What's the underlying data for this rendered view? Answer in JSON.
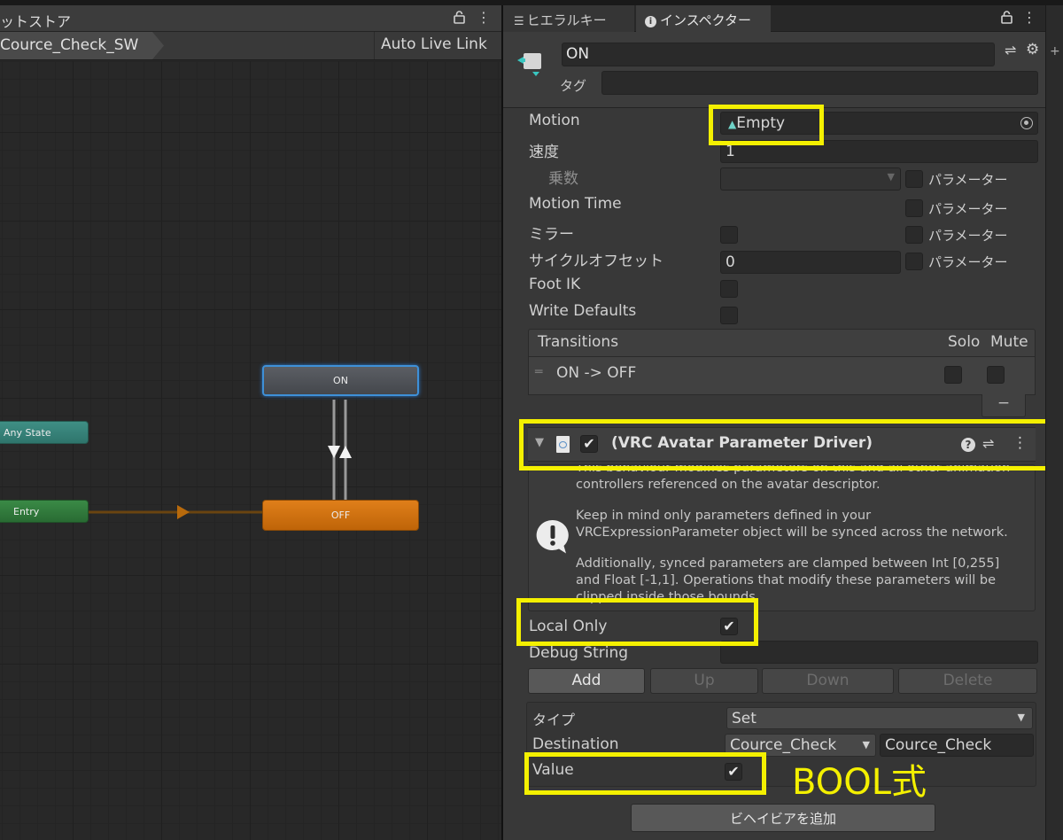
{
  "animator": {
    "tab_title": "ットストア",
    "breadcrumb": "Cource_Check_SW",
    "auto_live_link": "Auto Live Link",
    "nodes": {
      "on": "ON",
      "off": "OFF",
      "any_state": "Any State",
      "entry": "Entry"
    }
  },
  "tabs": {
    "hierarchy": "ヒエラルキー",
    "inspector": "インスペクター"
  },
  "inspector": {
    "object_name": "ON",
    "tag_label": "タグ",
    "motion_label": "Motion",
    "motion_value": "Empty",
    "speed_label": "速度",
    "speed_value": "1",
    "multiplier_label": "乗数",
    "parameter_label": "パラメーター",
    "motion_time_label": "Motion Time",
    "mirror_label": "ミラー",
    "cycle_offset_label": "サイクルオフセット",
    "cycle_offset_value": "0",
    "foot_ik_label": "Foot IK",
    "write_defaults_label": "Write Defaults",
    "transitions": {
      "header": "Transitions",
      "solo": "Solo",
      "mute": "Mute",
      "items": [
        "ON -> OFF"
      ],
      "remove": "−"
    },
    "driver": {
      "title": "(VRC Avatar Parameter Driver)",
      "help_line1": "This behaviour modifies parameters on this and all other animation",
      "help_line2": "controllers referenced on the avatar descriptor.",
      "help_line3": "Keep in mind only parameters defined in your",
      "help_line4": "VRCExpressionParameter object will be synced across the network.",
      "help_line5": "Additionally, synced parameters are clamped between Int [0,255]",
      "help_line6": "and Float [-1,1]. Operations that modify these parameters will be",
      "help_line7": "clipped inside those bounds.",
      "local_only_label": "Local Only",
      "local_only_checked": true,
      "debug_string_label": "Debug String",
      "debug_string_value": "",
      "buttons": {
        "add": "Add",
        "up": "Up",
        "down": "Down",
        "delete": "Delete"
      },
      "entry": {
        "type_label": "タイプ",
        "type_value": "Set",
        "destination_label": "Destination",
        "destination_select": "Cource_Check",
        "destination_field": "Cource_Check",
        "value_label": "Value",
        "value_checked": true
      }
    },
    "add_behaviour": "ビヘイビアを追加"
  },
  "annotation": "BOOL式",
  "colors": {
    "highlight": "#f4f000",
    "node_selected_border": "#3e90d8",
    "node_default": "#e07f1a",
    "any_state": "#3f8f85",
    "entry": "#3a8a46"
  }
}
